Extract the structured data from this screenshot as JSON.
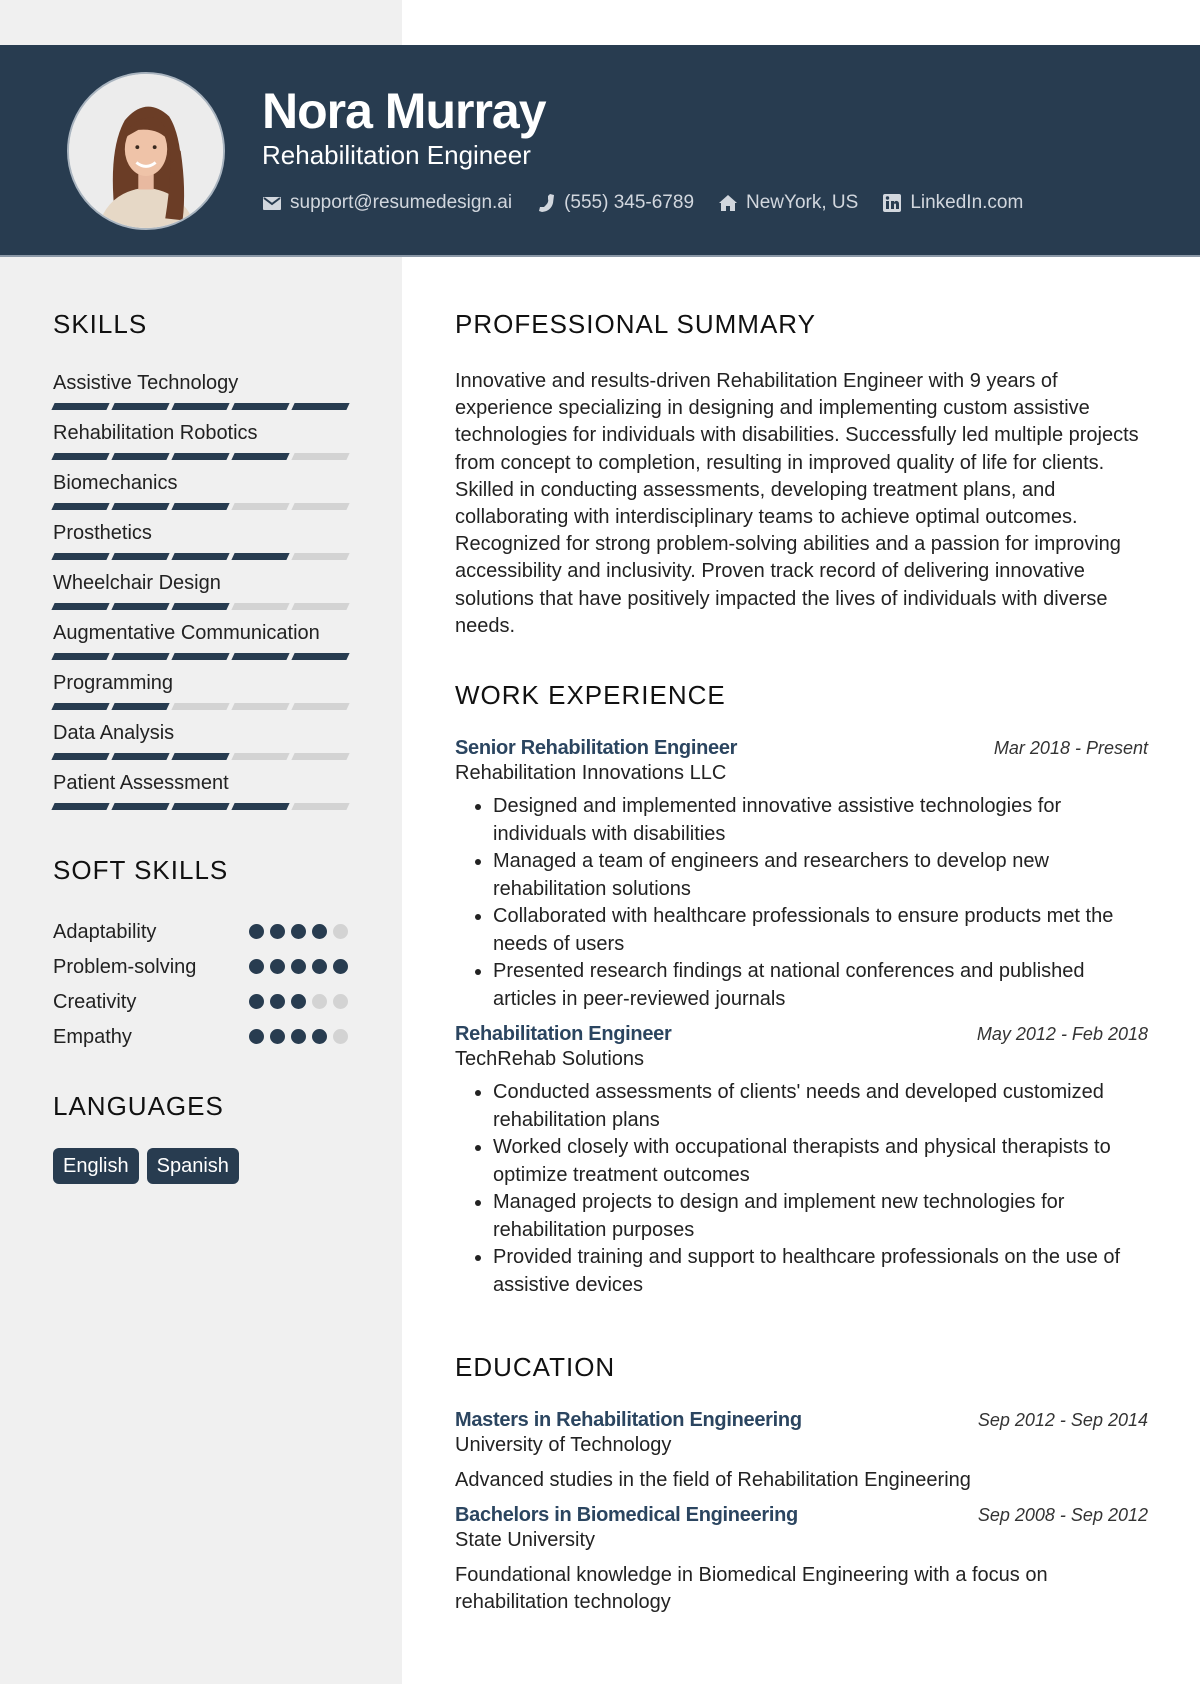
{
  "header": {
    "name": "Nora Murray",
    "title": "Rehabilitation Engineer",
    "contacts": [
      {
        "icon": "envelope-icon",
        "text": "support@resumedesign.ai"
      },
      {
        "icon": "phone-icon",
        "text": "(555) 345-6789"
      },
      {
        "icon": "home-icon",
        "text": "NewYork, US"
      },
      {
        "icon": "linkedin-icon",
        "text": "LinkedIn.com"
      }
    ]
  },
  "colors": {
    "primary": "#283c50",
    "sidebar_bg": "#f0f0f0",
    "inactive": "#d3d3d3",
    "accent_text": "#2b4560"
  },
  "skills": {
    "heading": "SKILLS",
    "max": 5,
    "items": [
      {
        "name": "Assistive Technology",
        "level": 5
      },
      {
        "name": "Rehabilitation Robotics",
        "level": 4
      },
      {
        "name": "Biomechanics",
        "level": 3
      },
      {
        "name": "Prosthetics",
        "level": 4
      },
      {
        "name": "Wheelchair Design",
        "level": 3
      },
      {
        "name": "Augmentative Communication",
        "level": 5
      },
      {
        "name": "Programming",
        "level": 2
      },
      {
        "name": "Data Analysis",
        "level": 3
      },
      {
        "name": "Patient Assessment",
        "level": 4
      }
    ]
  },
  "soft_skills": {
    "heading": "SOFT SKILLS",
    "max": 5,
    "items": [
      {
        "name": "Adaptability",
        "level": 4
      },
      {
        "name": "Problem-solving",
        "level": 5
      },
      {
        "name": "Creativity",
        "level": 3
      },
      {
        "name": "Empathy",
        "level": 4
      }
    ]
  },
  "languages": {
    "heading": "LANGUAGES",
    "items": [
      "English",
      "Spanish"
    ]
  },
  "summary": {
    "heading": "PROFESSIONAL SUMMARY",
    "text": "Innovative and results-driven Rehabilitation Engineer with 9 years of experience specializing in designing and implementing custom assistive technologies for individuals with disabilities. Successfully led multiple projects from concept to completion, resulting in improved quality of life for clients. Skilled in conducting assessments, developing treatment plans, and collaborating with interdisciplinary teams to achieve optimal outcomes. Recognized for strong problem-solving abilities and a passion for improving accessibility and inclusivity. Proven track record of delivering innovative solutions that have positively impacted the lives of individuals with diverse needs."
  },
  "experience": {
    "heading": "WORK EXPERIENCE",
    "jobs": [
      {
        "title": "Senior Rehabilitation Engineer",
        "dates": "Mar 2018 - Present",
        "company": "Rehabilitation Innovations LLC",
        "bullets": [
          "Designed and implemented innovative assistive technologies for individuals with disabilities",
          "Managed a team of engineers and researchers to develop new rehabilitation solutions",
          "Collaborated with healthcare professionals to ensure products met the needs of users",
          "Presented research findings at national conferences and published articles in peer-reviewed journals"
        ]
      },
      {
        "title": "Rehabilitation Engineer",
        "dates": "May 2012 - Feb 2018",
        "company": "TechRehab Solutions",
        "bullets": [
          "Conducted assessments of clients' needs and developed customized rehabilitation plans",
          "Worked closely with occupational therapists and physical therapists to optimize treatment outcomes",
          "Managed projects to design and implement new technologies for rehabilitation purposes",
          "Provided training and support to healthcare professionals on the use of assistive devices"
        ]
      }
    ]
  },
  "education": {
    "heading": "EDUCATION",
    "items": [
      {
        "degree": "Masters in Rehabilitation Engineering",
        "dates": "Sep 2012 - Sep 2014",
        "school": "University of Technology",
        "description": "Advanced studies in the field of Rehabilitation Engineering"
      },
      {
        "degree": "Bachelors in Biomedical Engineering",
        "dates": "Sep 2008 - Sep 2012",
        "school": "State University",
        "description": "Foundational knowledge in Biomedical Engineering with a focus on rehabilitation technology"
      }
    ]
  }
}
